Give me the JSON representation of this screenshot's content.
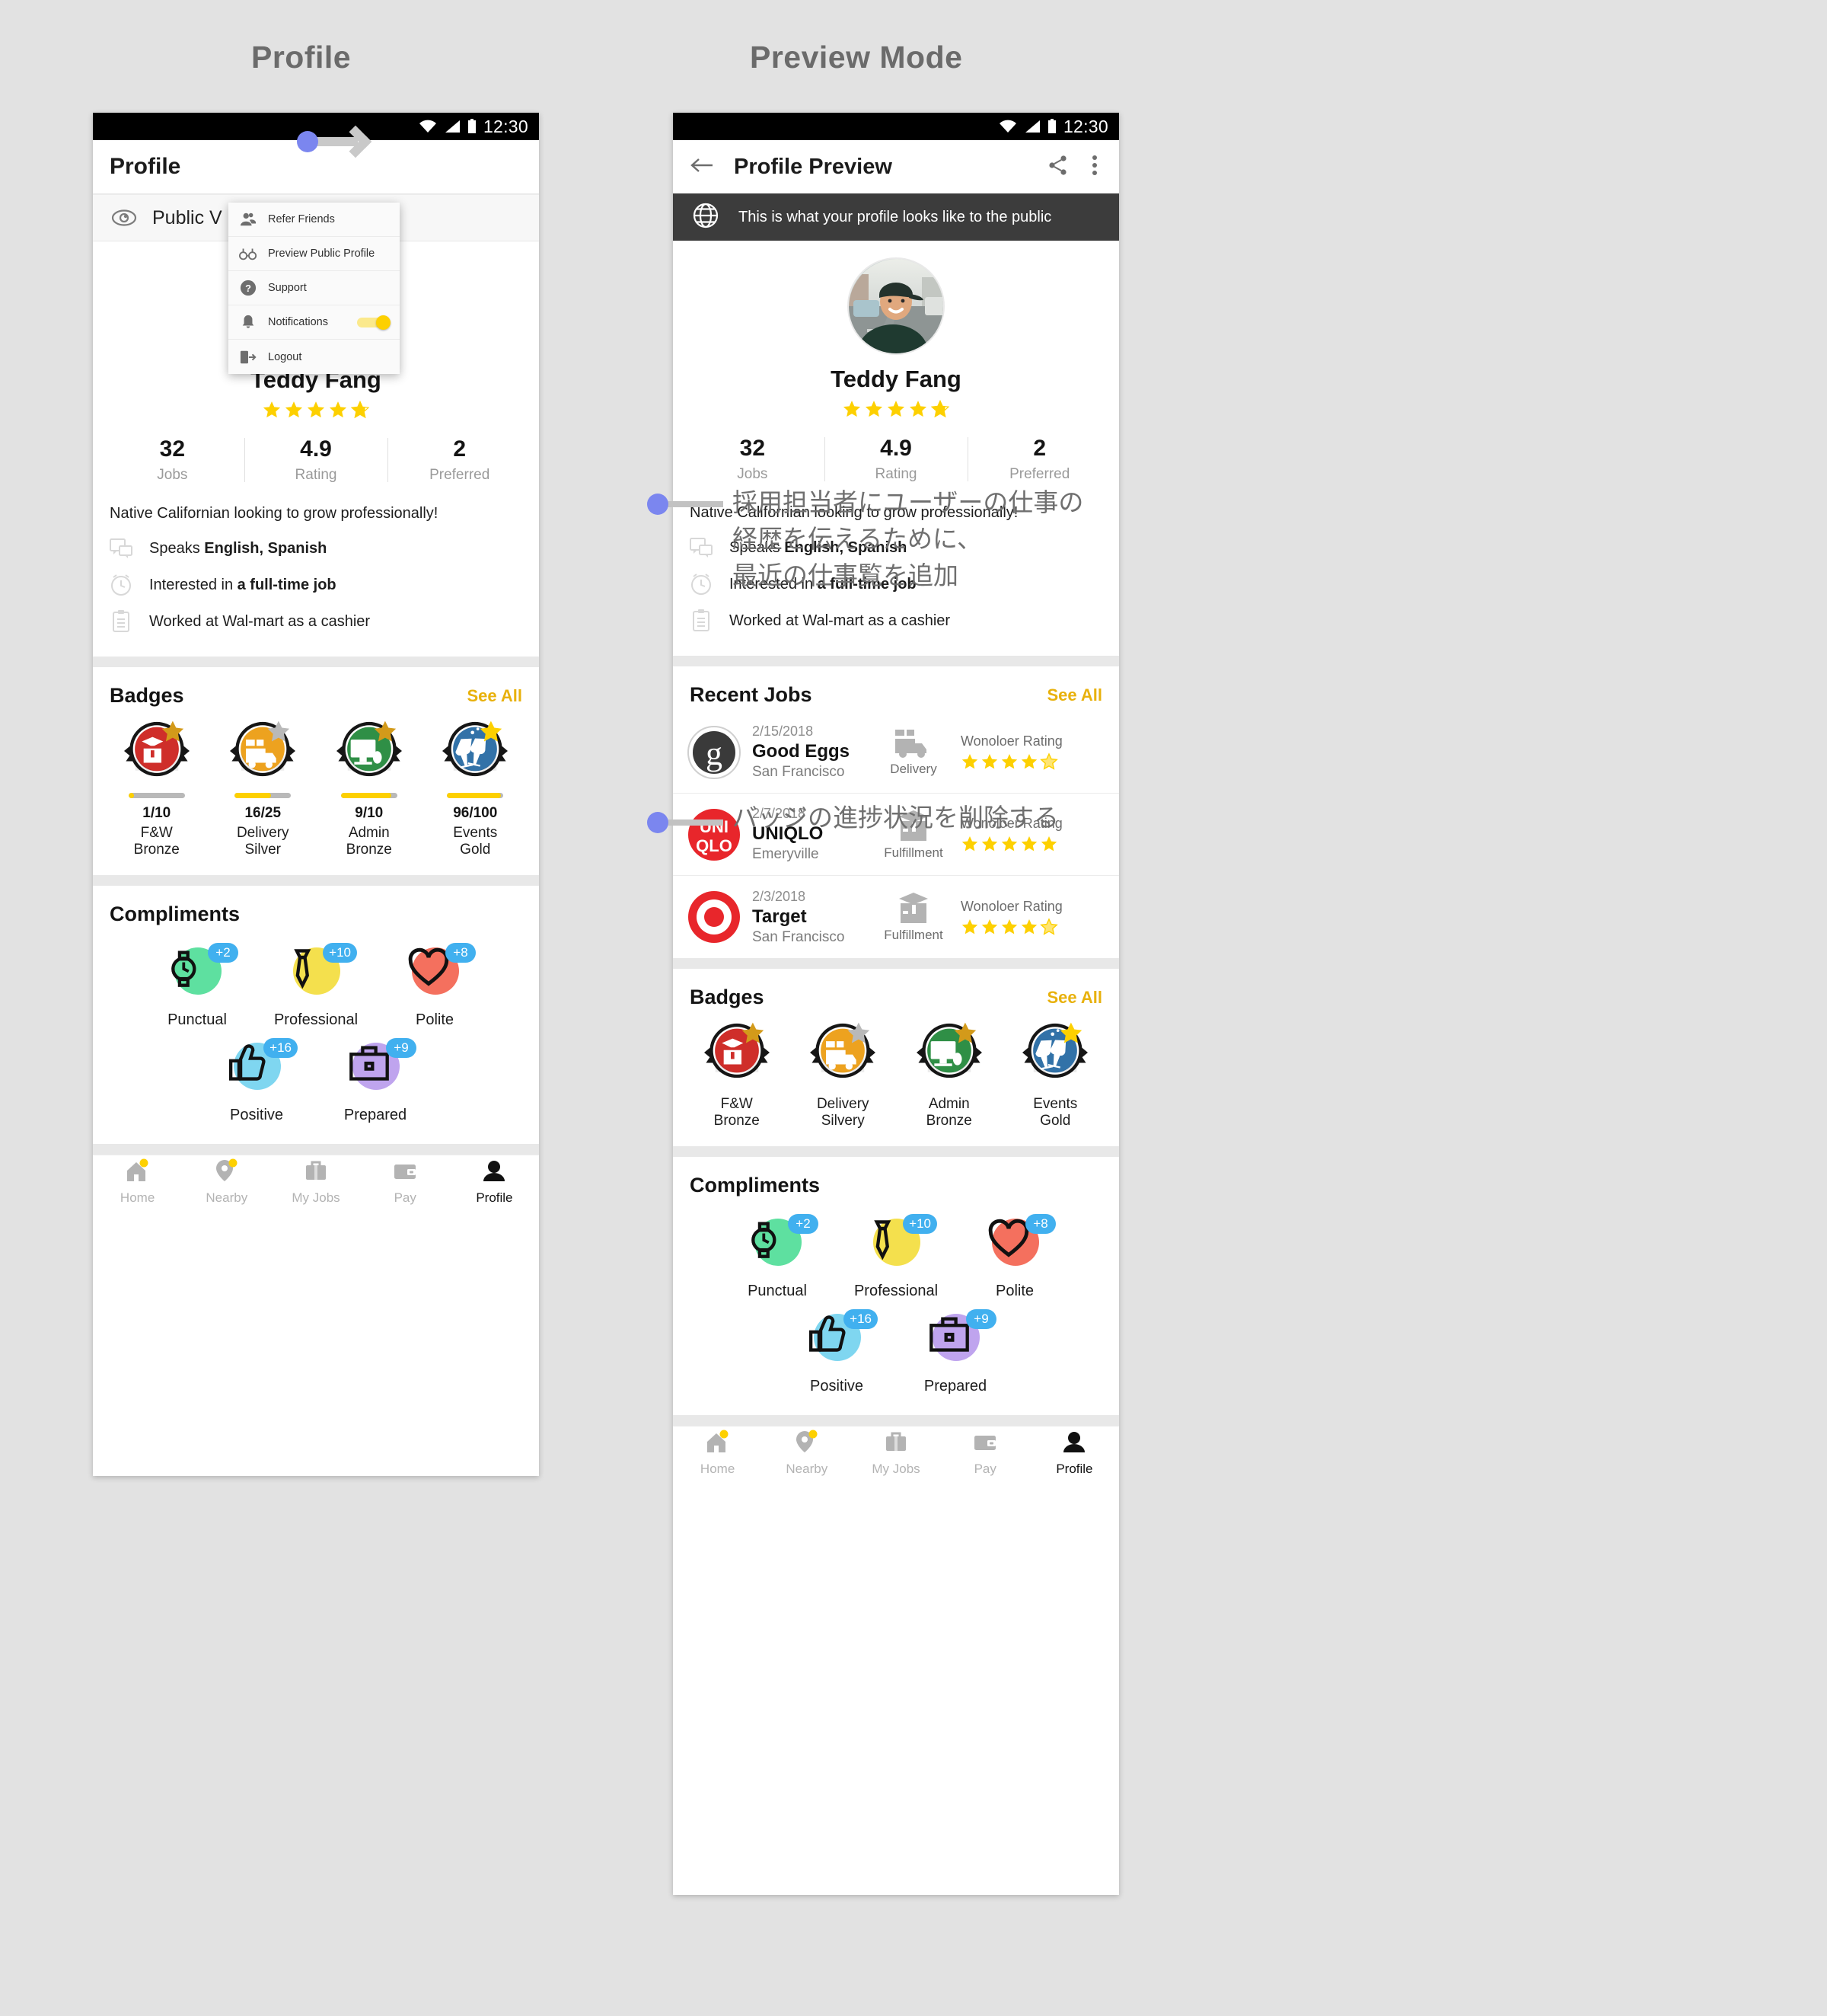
{
  "page": {
    "background": "#e2e2e2",
    "left_title": "Profile",
    "right_title": "Preview Mode"
  },
  "statusbar": {
    "time": "12:30"
  },
  "left_phone": {
    "appbar": {
      "title": "Profile"
    },
    "public_row": {
      "label": "Public V",
      "icon": "eye-icon"
    },
    "menu": {
      "items": [
        {
          "label": "Refer Friends",
          "icon": "person-add-icon"
        },
        {
          "label": "Preview Public Profile",
          "icon": "glasses-icon"
        },
        {
          "label": "Support",
          "icon": "question-circle-icon"
        },
        {
          "label": "Notifications",
          "icon": "bell-icon",
          "toggle": true,
          "toggle_on": true
        },
        {
          "label": "Logout",
          "icon": "logout-icon"
        }
      ]
    }
  },
  "right_phone": {
    "appbar": {
      "title": "Profile Preview",
      "back_icon": "arrow-left-icon",
      "share_icon": "share-icon",
      "overflow_icon": "more-vertical-icon"
    },
    "banner": {
      "icon": "globe-icon",
      "text": "This is what your profile looks like to the public"
    },
    "recent_jobs": {
      "title": "Recent Jobs",
      "see_all": "See All",
      "rows": [
        {
          "logo": "good-eggs-logo",
          "date": "2/15/2018",
          "name": "Good Eggs",
          "city": "San Francisco",
          "type": "Delivery",
          "type_icon": "truck-icon",
          "rating_label": "Wonoloer Rating",
          "rating": 4.5
        },
        {
          "logo": "uniqlo-logo",
          "date": "2/7/2018",
          "name": "UNIQLO",
          "city": "Emeryville",
          "type": "Fulfillment",
          "type_icon": "box-icon",
          "rating_label": "Wonoloer Rating",
          "rating": 5
        },
        {
          "logo": "target-logo",
          "date": "2/3/2018",
          "name": "Target",
          "city": "San Francisco",
          "type": "Fulfillment",
          "type_icon": "box-icon",
          "rating_label": "Wonoloer Rating",
          "rating": 4.5
        }
      ]
    },
    "badges": {
      "title": "Badges",
      "see_all": "See All",
      "items": [
        {
          "color": "#cf2e2a",
          "star": "#d39a1a",
          "icon": "open-box-icon",
          "label_line1": "F&W",
          "label_line2": "Bronze"
        },
        {
          "color": "#eda21f",
          "star": "#b9b9b9",
          "icon": "truck-icon",
          "label_line1": "Delivery",
          "label_line2": "Silvery"
        },
        {
          "color": "#2f8f46",
          "star": "#d39a1a",
          "icon": "monitor-icon",
          "label_line1": "Admin",
          "label_line2": "Bronze"
        },
        {
          "color": "#3272a8",
          "star": "#fdd000",
          "icon": "cheers-icon",
          "label_line1": "Events",
          "label_line2": "Gold"
        }
      ]
    }
  },
  "profile": {
    "name": "Teddy Fang",
    "rating_stars": 4.9,
    "avatar": "teddy-fang-photo",
    "stats": [
      {
        "value": "32",
        "label": "Jobs"
      },
      {
        "value": "4.9",
        "label": "Rating"
      },
      {
        "value": "2",
        "label": "Preferred"
      }
    ],
    "bio": "Native Californian looking to grow professionally!",
    "facts": [
      {
        "icon": "chat-icon",
        "prefix": "Speaks ",
        "bold": "English, Spanish",
        "suffix": ""
      },
      {
        "icon": "clock-icon",
        "prefix": "Interested in ",
        "bold": "a full-time job",
        "suffix": ""
      },
      {
        "icon": "clipboard-icon",
        "prefix": "Worked at Wal-mart as a cashier",
        "bold": "",
        "suffix": ""
      }
    ]
  },
  "badges_progress": {
    "title": "Badges",
    "see_all": "See All",
    "items": [
      {
        "color": "#cf2e2a",
        "star": "#d39a1a",
        "icon": "open-box-icon",
        "progress": "1/10",
        "pct": 10,
        "label_line1": "F&W",
        "label_line2": "Bronze"
      },
      {
        "color": "#eda21f",
        "star": "#b9b9b9",
        "icon": "truck-icon",
        "progress": "16/25",
        "pct": 64,
        "label_line1": "Delivery",
        "label_line2": "Silver"
      },
      {
        "color": "#2f8f46",
        "star": "#d39a1a",
        "icon": "monitor-icon",
        "progress": "9/10",
        "pct": 90,
        "label_line1": "Admin",
        "label_line2": "Bronze"
      },
      {
        "color": "#3272a8",
        "star": "#fdd000",
        "icon": "cheers-icon",
        "progress": "96/100",
        "pct": 96,
        "label_line1": "Events",
        "label_line2": "Gold"
      }
    ]
  },
  "compliments": {
    "title": "Compliments",
    "row1": [
      {
        "label": "Punctual",
        "count": "+2",
        "blob": "#5ee0a0",
        "icon": "watch-icon"
      },
      {
        "label": "Professional",
        "count": "+10",
        "blob": "#f4e04d",
        "icon": "tie-icon"
      },
      {
        "label": "Polite",
        "count": "+8",
        "blob": "#f4705e",
        "icon": "heart-icon"
      }
    ],
    "row2": [
      {
        "label": "Positive",
        "count": "+16",
        "blob": "#7fd6f0",
        "icon": "thumbs-up-icon"
      },
      {
        "label": "Prepared",
        "count": "+9",
        "blob": "#bfa4ee",
        "icon": "briefcase-icon"
      }
    ]
  },
  "bottom_nav": {
    "items": [
      {
        "label": "Home",
        "icon": "home-icon",
        "active": false
      },
      {
        "label": "Nearby",
        "icon": "pin-icon",
        "active": false
      },
      {
        "label": "My Jobs",
        "icon": "briefcase-icon",
        "active": false
      },
      {
        "label": "Pay",
        "icon": "wallet-icon",
        "active": false
      },
      {
        "label": "Profile",
        "icon": "person-icon",
        "active": true
      }
    ]
  },
  "annotations": [
    {
      "text": "採用担当者にユーザーの仕事の\n経歴を伝えるために、\n最近の仕事覧を追加"
    },
    {
      "text": "バッジの進捗状況を削除する"
    }
  ],
  "colors": {
    "accent_yellow": "#e8b10c",
    "star_yellow": "#fdd000",
    "dot_blue": "#7b86ef",
    "banner_dark": "#3c3c3c"
  }
}
